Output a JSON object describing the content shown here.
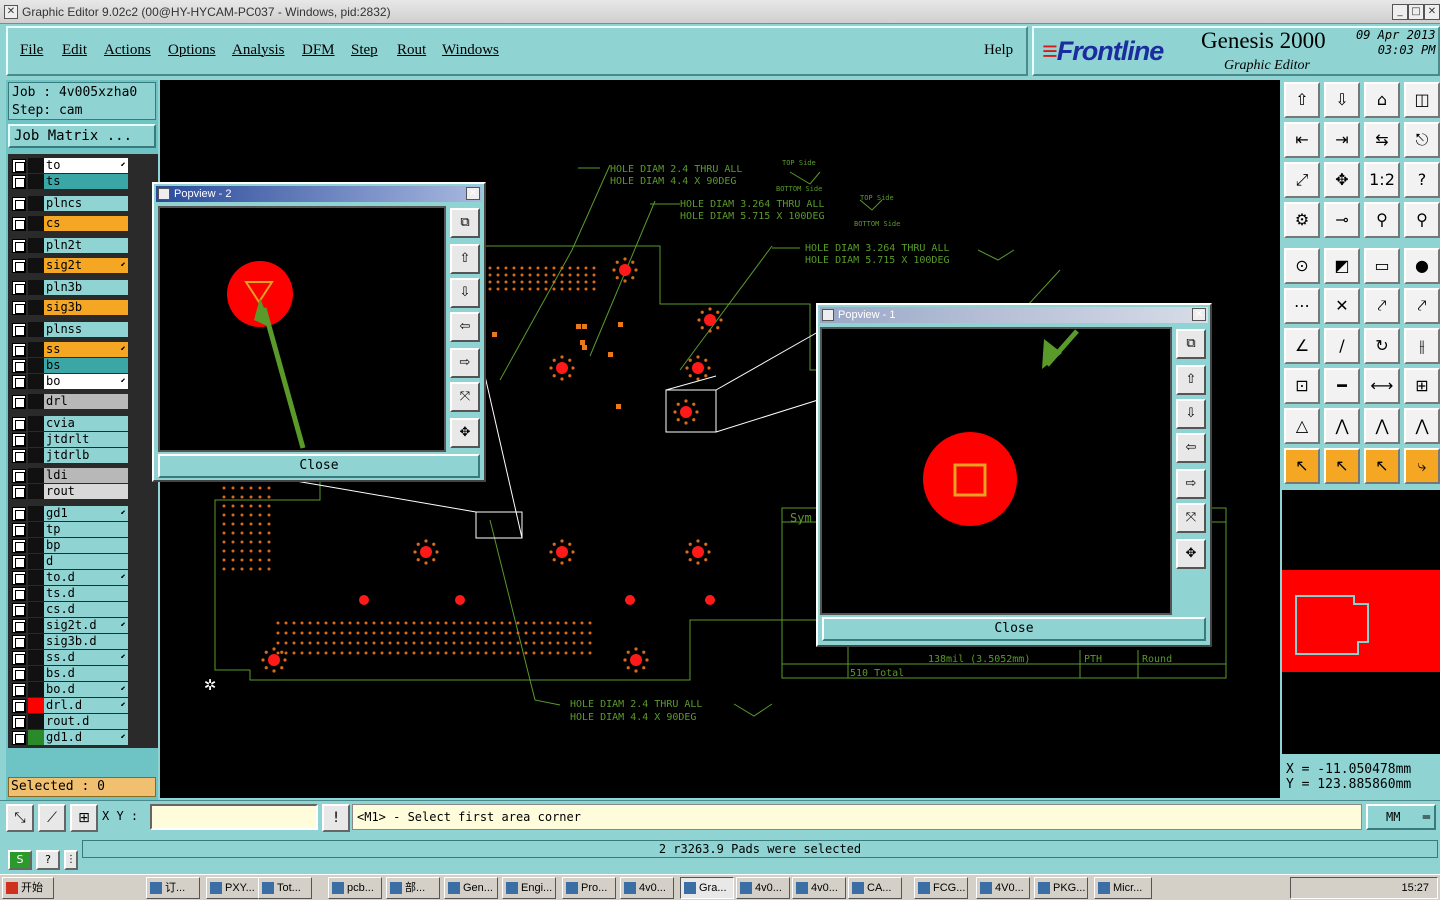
{
  "window": {
    "title": "Graphic Editor 9.02c2 (00@HY-HYCAM-PC037 - Windows, pid:2832)"
  },
  "menu": [
    "File",
    "Edit",
    "Actions",
    "Options",
    "Analysis",
    "DFM",
    "Step",
    "Rout",
    "Windows"
  ],
  "help": "Help",
  "brand": {
    "logo": "Frontline",
    "product": "Genesis 2000",
    "subtitle": "Graphic Editor",
    "date": "09 Apr 2013",
    "time": "03:03 PM"
  },
  "job": {
    "job": "Job : 4v005xzha0",
    "step": "Step: cam",
    "matrix": "Job Matrix ..."
  },
  "layers": [
    {
      "name": "to",
      "color": "#ffffff",
      "arrow": true
    },
    {
      "name": "ts",
      "color": "#3aa6a6",
      "arrow": false
    },
    {
      "name": "plncs",
      "color": "#8fd3d3",
      "arrow": false
    },
    {
      "name": "cs",
      "color": "#f5a623",
      "arrow": false
    },
    {
      "name": "pln2t",
      "color": "#8fd3d3",
      "arrow": false
    },
    {
      "name": "sig2t",
      "color": "#f5a623",
      "arrow": true
    },
    {
      "name": "pln3b",
      "color": "#8fd3d3",
      "arrow": false
    },
    {
      "name": "sig3b",
      "color": "#f5a623",
      "arrow": false
    },
    {
      "name": "plnss",
      "color": "#8fd3d3",
      "arrow": false
    },
    {
      "name": "ss",
      "color": "#f5a623",
      "arrow": true
    },
    {
      "name": "bs",
      "color": "#3aa6a6",
      "arrow": false
    },
    {
      "name": "bo",
      "color": "#ffffff",
      "arrow": true
    },
    {
      "name": "drl",
      "color": "#b8b8b8",
      "arrow": false
    },
    {
      "name": "cvia",
      "color": "#8fd3d3",
      "arrow": false
    },
    {
      "name": "jtdrlt",
      "color": "#8fd3d3",
      "arrow": false
    },
    {
      "name": "jtdrlb",
      "color": "#8fd3d3",
      "arrow": false
    },
    {
      "name": "ldi",
      "color": "#b8b8b8",
      "arrow": false
    },
    {
      "name": "rout",
      "color": "#d8d8d8",
      "arrow": false
    },
    {
      "name": "gd1",
      "color": "#8fd3d3",
      "arrow": true
    },
    {
      "name": "tp",
      "color": "#8fd3d3",
      "arrow": false
    },
    {
      "name": "bp",
      "color": "#8fd3d3",
      "arrow": false
    },
    {
      "name": "d",
      "color": "#8fd3d3",
      "arrow": false
    },
    {
      "name": "to.d",
      "color": "#8fd3d3",
      "arrow": true
    },
    {
      "name": "ts.d",
      "color": "#8fd3d3",
      "arrow": false
    },
    {
      "name": "cs.d",
      "color": "#8fd3d3",
      "arrow": false
    },
    {
      "name": "sig2t.d",
      "color": "#8fd3d3",
      "arrow": true
    },
    {
      "name": "sig3b.d",
      "color": "#8fd3d3",
      "arrow": false
    },
    {
      "name": "ss.d",
      "color": "#8fd3d3",
      "arrow": true
    },
    {
      "name": "bs.d",
      "color": "#8fd3d3",
      "arrow": false
    },
    {
      "name": "bo.d",
      "color": "#8fd3d3",
      "arrow": true
    },
    {
      "name": "drl.d",
      "color": "#8fd3d3",
      "arrow": true
    },
    {
      "name": "rout.d",
      "color": "#8fd3d3",
      "arrow": false
    },
    {
      "name": "gd1.d",
      "color": "#8fd3d3",
      "arrow": true
    }
  ],
  "selected": "Selected : 0",
  "canvas": {
    "note1a": "HOLE DIAM 2.4 THRU ALL",
    "note1b": "HOLE DIAM 4.4  X 90DEG",
    "note2a": "HOLE DIAM 3.264 THRU ALL",
    "note2b": "HOLE DIAM 5.715 X 100DEG",
    "note3a": "HOLE DIAM 3.264 THRU ALL",
    "note3b": "HOLE DIAM 5.715 X 100DEG",
    "note4a": "HOLE DIAM 2.4 THRU ALL",
    "note4b": "HOLE DIAM 4.4  X 90DEG",
    "top_side": "TOP Side",
    "bottom_side": "BOTTOM Side",
    "sym": "Sym",
    "table_row1": "138mil (3.5052mm)",
    "table_pth": "PTH",
    "table_round": "Round",
    "table_total": "510 Total"
  },
  "popview2": {
    "title": "Popview - 2",
    "close": "Close"
  },
  "popview1": {
    "title": "Popview - 1",
    "close": "Close"
  },
  "coords": {
    "x": "X  = -11.050478mm",
    "y": "Y  = 123.885860mm"
  },
  "bottom": {
    "xy_label": "X Y :",
    "prompt": "<M1> - Select first area corner",
    "units": "MM"
  },
  "status": "2 r3263.9 Pads were selected",
  "taskbar": {
    "start": "开始",
    "items": [
      "订...",
      "PXY...",
      "Tot...",
      "pcb...",
      "部...",
      "Gen...",
      "Engi...",
      "Pro...",
      "4v0...",
      "Gra...",
      "4v0...",
      "4v0...",
      "CA...",
      "FCG...",
      "4V0...",
      "PKG...",
      "Micr..."
    ],
    "clock": "15:27"
  }
}
